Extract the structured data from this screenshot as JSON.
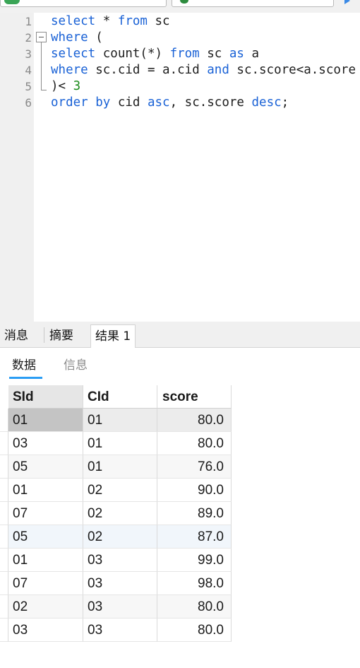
{
  "editor": {
    "lines": [
      {
        "num": "1",
        "parts": [
          [
            "kw",
            "select"
          ],
          [
            "t",
            " * "
          ],
          [
            "kw",
            "from"
          ],
          [
            "t",
            " sc"
          ]
        ]
      },
      {
        "num": "2",
        "parts": [
          [
            "kw",
            "where"
          ],
          [
            "t",
            " ("
          ]
        ]
      },
      {
        "num": "3",
        "parts": [
          [
            "kw",
            "select"
          ],
          [
            "t",
            " count(*) "
          ],
          [
            "kw",
            "from"
          ],
          [
            "t",
            " sc "
          ],
          [
            "kw",
            "as"
          ],
          [
            "t",
            " a"
          ]
        ]
      },
      {
        "num": "4",
        "parts": [
          [
            "kw",
            "where"
          ],
          [
            "t",
            " sc.cid = a.cid "
          ],
          [
            "kw",
            "and"
          ],
          [
            "t",
            " sc.score<a.score"
          ]
        ]
      },
      {
        "num": "5",
        "parts": [
          [
            "t",
            ")< "
          ],
          [
            "num",
            "3"
          ]
        ]
      },
      {
        "num": "6",
        "parts": [
          [
            "kw",
            "order by"
          ],
          [
            "t",
            " cid "
          ],
          [
            "kw",
            "asc"
          ],
          [
            "t",
            ", sc.score "
          ],
          [
            "kw",
            "desc"
          ],
          [
            "t",
            ";"
          ]
        ]
      }
    ]
  },
  "bottom_tabs": [
    "消息",
    "摘要",
    "结果 1"
  ],
  "active_bottom_tab": "结果 1",
  "sub_tabs": [
    "数据",
    "信息"
  ],
  "active_sub_tab": "数据",
  "table": {
    "columns": [
      "SId",
      "CId",
      "score"
    ],
    "rows": [
      [
        "01",
        "01",
        "80.0"
      ],
      [
        "03",
        "01",
        "80.0"
      ],
      [
        "05",
        "01",
        "76.0"
      ],
      [
        "01",
        "02",
        "90.0"
      ],
      [
        "07",
        "02",
        "89.0"
      ],
      [
        "05",
        "02",
        "87.0"
      ],
      [
        "01",
        "03",
        "99.0"
      ],
      [
        "07",
        "03",
        "98.0"
      ],
      [
        "02",
        "03",
        "80.0"
      ],
      [
        "03",
        "03",
        "80.0"
      ]
    ]
  },
  "colors": {
    "keyword": "#1a62d6",
    "number": "#1a8a1a",
    "accent": "#2a9df4"
  },
  "icons": [
    "connection-icon",
    "database-icon",
    "run-icon"
  ]
}
